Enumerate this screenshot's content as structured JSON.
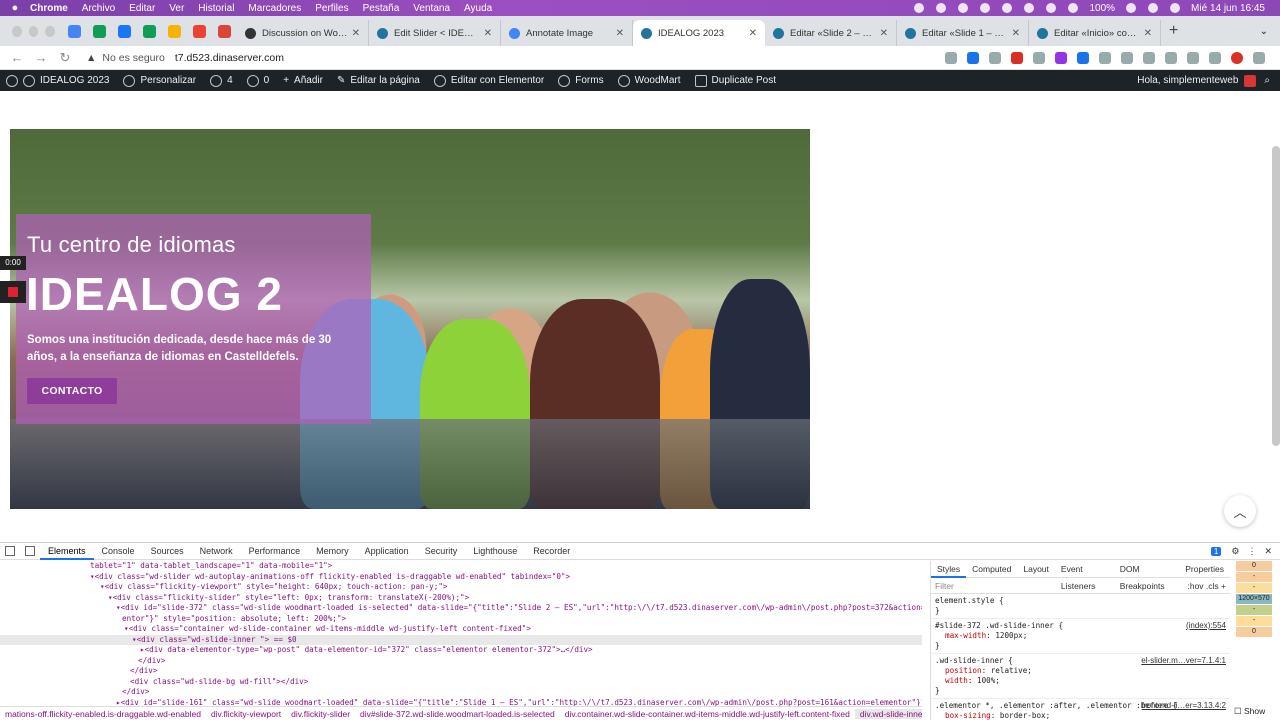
{
  "menubar": {
    "items": [
      "Chrome",
      "Archivo",
      "Editar",
      "Ver",
      "Historial",
      "Marcadores",
      "Perfiles",
      "Pestaña",
      "Ventana",
      "Ayuda"
    ],
    "battery": "100%",
    "datetime": "Mié 14 jun  16:45"
  },
  "tabs": [
    {
      "title": "Discussion on WoodMa",
      "color": "#333333"
    },
    {
      "title": "Edit Slider < IDEALOG 2",
      "color": "#21759b"
    },
    {
      "title": "Annotate Image",
      "color": "#4285f4"
    },
    {
      "title": "IDEALOG 2023",
      "color": "#21759b",
      "active": true
    },
    {
      "title": "Editar «Slide 2 – ES» co",
      "color": "#21759b"
    },
    {
      "title": "Editar «Slide 1 – ES» co",
      "color": "#21759b"
    },
    {
      "title": "Editar «Inicio» con Ele",
      "color": "#21759b"
    }
  ],
  "addressbar": {
    "security": "No es seguro",
    "url": "t7.d523.dinaserver.com"
  },
  "wpbar": {
    "site": "IDEALOG 2023",
    "customize": "Personalizar",
    "updates": "4",
    "comments": "0",
    "new": "Añadir",
    "edit_page": "Editar la página",
    "elementor": "Editar con Elementor",
    "forms": "Forms",
    "woodmart": "WoodMart",
    "duplicate": "Duplicate Post",
    "greeting": "Hola, simplementeweb"
  },
  "slide": {
    "subtitle": "Tu centro de idiomas",
    "title": "IDEALOG 2",
    "description": "Somos una institución dedicada, desde hace más de 30 años, a la enseñanza de idiomas en Castelldefels.",
    "button": "CONTACTO",
    "overlay_color": "#b25fb9"
  },
  "recorder": {
    "timer": "0:00"
  },
  "devtools": {
    "tabs": [
      "Elements",
      "Console",
      "Sources",
      "Network",
      "Performance",
      "Memory",
      "Application",
      "Security",
      "Lighthouse",
      "Recorder"
    ],
    "issues_badge": "1",
    "dom_lines": [
      "tablet=\"1\" data-tablet_landscape=\"1\" data-mobile=\"1\">",
      "▾<div class=\"wd-slider wd-autoplay-animations-off flickity-enabled is-draggable wd-enabled\" tabindex=\"0\">",
      "▾<div class=\"flickity-viewport\" style=\"height: 640px; touch-action: pan-y;\">",
      "▾<div class=\"flickity-slider\" style=\"left: 0px; transform: translateX(-200%);\">",
      "▾<div id=\"slide-372\" class=\"wd-slide woodmart-loaded is-selected\" data-slide=\"{\"title\":\"Slide 2 – ES\",\"url\":\"http:\\/\\/t7.d523.dinaserver.com\\/wp-admin\\/post.php?post=372&action=edit",
      "entor\"}\" style=\"position: absolute; left: 200%;\">",
      "▾<div class=\"container wd-slide-container wd-items-middle wd-justify-left content-fixed\">",
      "▾<div class=\"wd-slide-inner \"> == $0",
      "▸<div data-elementor-type=\"wp-post\" data-elementor-id=\"372\" class=\"elementor elementor-372\">…</div>",
      "</div>",
      "</div>",
      "<div class=\"wd-slide-bg wd-fill\"></div>",
      "</div>",
      "▸<div id=\"slide-161\" class=\"wd-slide woodmart-loaded\" data-slide=\"{\"title\":\"Slide 1 – ES\",\"url\":\"http:\\/\\/t7.d523.dinaserver.com\\/wp-admin\\/post.php?post=161&action=elementor\"}\""
    ],
    "breadcrumbs": [
      "mations-off.flickity-enabled.is-draggable.wd-enabled",
      "div.flickity-viewport",
      "div.flickity-slider",
      "div#slide-372.wd-slide.woodmart-loaded.is-selected",
      "div.container.wd-slide-container.wd-items-middle.wd-justify-left.content-fixed",
      "div.wd-slide-inner."
    ],
    "styles_tabs": [
      "Styles",
      "Computed",
      "Layout",
      "Event Listeners",
      "DOM Breakpoints",
      "Properties"
    ],
    "filter_placeholder": "Filter",
    "filter_opts": ":hov  .cls  +",
    "rules": [
      {
        "selector": "element.style {",
        "source": "",
        "props": []
      },
      {
        "selector": "#slide-372 .wd-slide-inner {",
        "source": "(index):554",
        "props": [
          [
            "max-width",
            "1200px;"
          ]
        ]
      },
      {
        "selector": ".wd-slide-inner {",
        "source": "el-slider.m…ver=7.1.4:1",
        "props": [
          [
            "position",
            "relative;"
          ],
          [
            "width",
            "100%;"
          ]
        ]
      },
      {
        "selector": ".elementor *, .elementor :after, .elementor :before {",
        "source": "frontend-li…er=3.13.4:2",
        "props": [
          [
            "box-sizing",
            "border-box;"
          ]
        ]
      }
    ],
    "boxmodel": [
      "0",
      "-",
      "-",
      "1200×570",
      "-",
      "-",
      "0"
    ],
    "show_label": "Show"
  }
}
